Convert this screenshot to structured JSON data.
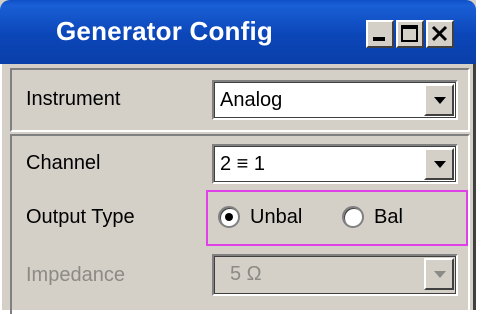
{
  "window": {
    "title": "Generator Config",
    "controls": [
      "minimize-icon",
      "maximize-icon",
      "close-icon"
    ]
  },
  "instrument": {
    "label": "Instrument",
    "value": "Analog"
  },
  "channel": {
    "label": "Channel",
    "value": "2 ≡ 1"
  },
  "output_type": {
    "label": "Output Type",
    "options": [
      {
        "label": "Unbal",
        "selected": true
      },
      {
        "label": "Bal",
        "selected": false
      }
    ],
    "highlight_color": "#e040e8"
  },
  "impedance": {
    "label": "Impedance",
    "value": "5 Ω",
    "enabled": false
  },
  "colors": {
    "titlebar": "#0b46b8",
    "panel": "#d4d0c8",
    "disabled_text": "#8c8a85"
  }
}
